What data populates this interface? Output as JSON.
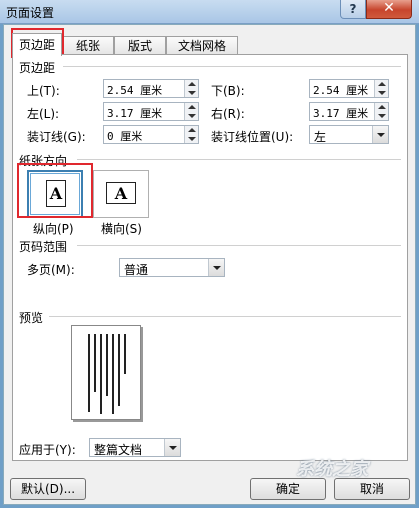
{
  "window": {
    "title": "页面设置",
    "help": "?",
    "close": "✕"
  },
  "tabs": [
    {
      "label": "页边距",
      "active": true
    },
    {
      "label": "纸张",
      "active": false
    },
    {
      "label": "版式",
      "active": false
    },
    {
      "label": "文档网格",
      "active": false
    }
  ],
  "margins": {
    "section": "页边距",
    "top": {
      "label": "上(T):",
      "value": "2.54 厘米"
    },
    "bottom": {
      "label": "下(B):",
      "value": "2.54 厘米"
    },
    "left": {
      "label": "左(L):",
      "value": "3.17 厘米"
    },
    "right": {
      "label": "右(R):",
      "value": "3.17 厘米"
    },
    "gutter": {
      "label": "装订线(G):",
      "value": "0 厘米"
    },
    "gutter_pos": {
      "label": "装订线位置(U):",
      "value": "左"
    }
  },
  "orientation": {
    "section": "纸张方向",
    "portrait": {
      "label": "纵向(P)",
      "glyph": "A",
      "selected": true
    },
    "landscape": {
      "label": "横向(S)",
      "glyph": "A",
      "selected": false
    }
  },
  "pages": {
    "section": "页码范围",
    "multiple_label": "多页(M):",
    "multiple_value": "普通"
  },
  "preview": {
    "section": "预览"
  },
  "apply": {
    "label": "应用于(Y):",
    "value": "整篇文档"
  },
  "buttons": {
    "default": "默认(D)...",
    "ok": "确定",
    "cancel": "取消"
  },
  "watermark": "系统之家",
  "accent_color": "#e0282e"
}
